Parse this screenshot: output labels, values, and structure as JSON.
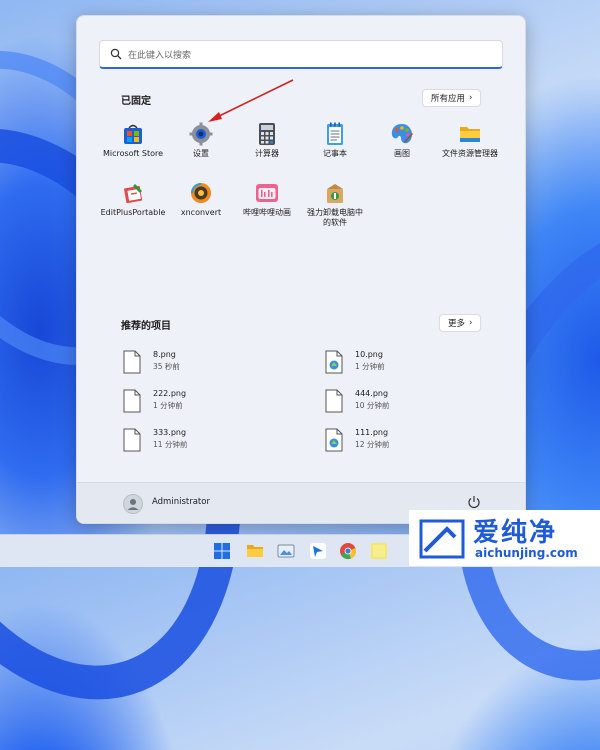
{
  "search": {
    "placeholder": "在此键入以搜索"
  },
  "pinned": {
    "title": "已固定",
    "all_apps_label": "所有应用",
    "apps": [
      {
        "label": "Microsoft Store",
        "icon": "store-icon"
      },
      {
        "label": "设置",
        "icon": "settings-gear-icon"
      },
      {
        "label": "计算器",
        "icon": "calculator-icon"
      },
      {
        "label": "记事本",
        "icon": "notepad-icon"
      },
      {
        "label": "画图",
        "icon": "paint-icon"
      },
      {
        "label": "文件资源管理器",
        "icon": "file-explorer-icon"
      },
      {
        "label": "EditPlusPortable",
        "icon": "editplus-icon"
      },
      {
        "label": "xnconvert",
        "icon": "xnconvert-icon"
      },
      {
        "label": "哔哩哔哩动画",
        "icon": "bilibili-icon"
      },
      {
        "label_line1": "强力卸载电脑中",
        "label_line2": "的软件",
        "icon": "uninstaller-icon"
      }
    ]
  },
  "recommended": {
    "title": "推荐的项目",
    "more_label": "更多",
    "files": [
      {
        "name": "8.png",
        "time": "35 秒前"
      },
      {
        "name": "10.png",
        "time": "1 分钟前"
      },
      {
        "name": "222.png",
        "time": "1 分钟前"
      },
      {
        "name": "444.png",
        "time": "10 分钟前"
      },
      {
        "name": "333.png",
        "time": "11 分钟前"
      },
      {
        "name": "111.png",
        "time": "12 分钟前"
      }
    ]
  },
  "user": {
    "name": "Administrator"
  },
  "watermark": {
    "brand": "爱纯净",
    "url": "aichunjing.com"
  },
  "colors": {
    "accent": "#2f69d8",
    "arrow": "#d42020",
    "brand": "#1f5bd8"
  }
}
